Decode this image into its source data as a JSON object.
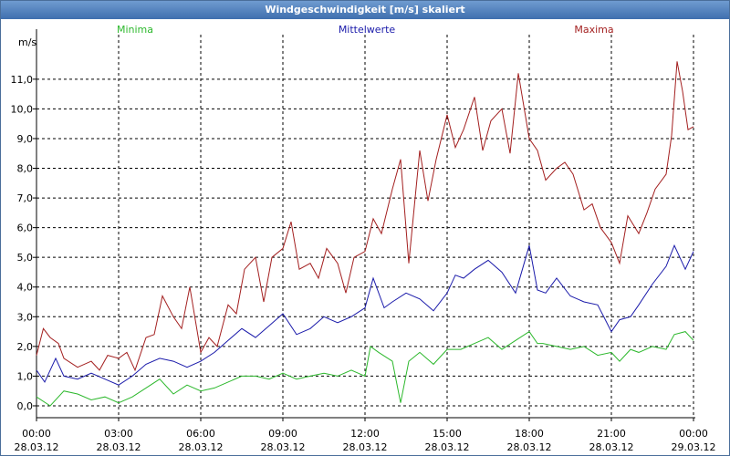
{
  "window": {
    "title": "Windgeschwindigkeit [m/s] skaliert"
  },
  "chart_data": {
    "type": "line",
    "title": "Windgeschwindigkeit [m/s] skaliert",
    "ylabel": "m/s",
    "ylim": [
      -0.4,
      12.5
    ],
    "xlim_hours": [
      0,
      24
    ],
    "yticks": [
      "0,0",
      "1,0",
      "2,0",
      "3,0",
      "4,0",
      "5,0",
      "6,0",
      "7,0",
      "8,0",
      "9,0",
      "10,0",
      "11,0"
    ],
    "xticks": [
      {
        "time": "00:00",
        "date": "28.03.12"
      },
      {
        "time": "03:00",
        "date": "28.03.12"
      },
      {
        "time": "06:00",
        "date": "28.03.12"
      },
      {
        "time": "09:00",
        "date": "28.03.12"
      },
      {
        "time": "12:00",
        "date": "28.03.12"
      },
      {
        "time": "15:00",
        "date": "28.03.12"
      },
      {
        "time": "18:00",
        "date": "28.03.12"
      },
      {
        "time": "21:00",
        "date": "28.03.12"
      },
      {
        "time": "00:00",
        "date": "29.03.12"
      }
    ],
    "grid": true,
    "legend_placement": "top",
    "series": [
      {
        "name": "Minima",
        "color": "#2cb82c",
        "x": [
          0,
          0.5,
          1,
          1.5,
          2,
          2.5,
          3,
          3.5,
          4,
          4.5,
          5,
          5.5,
          6,
          6.5,
          7,
          7.5,
          8,
          8.5,
          9,
          9.5,
          10,
          10.5,
          11,
          11.5,
          12,
          12.2,
          12.5,
          13,
          13.3,
          13.6,
          14,
          14.5,
          15,
          15.5,
          16,
          16.5,
          17,
          17.5,
          18,
          18.3,
          18.5,
          19,
          19.5,
          20,
          20.5,
          21,
          21.3,
          21.7,
          22,
          22.5,
          23,
          23.3,
          23.7,
          24
        ],
        "values": [
          0.3,
          0.0,
          0.5,
          0.4,
          0.2,
          0.3,
          0.1,
          0.3,
          0.6,
          0.9,
          0.4,
          0.7,
          0.5,
          0.6,
          0.8,
          1.0,
          1.0,
          0.9,
          1.1,
          0.9,
          1.0,
          1.1,
          1.0,
          1.2,
          1.0,
          2.0,
          1.8,
          1.5,
          0.1,
          1.5,
          1.8,
          1.4,
          1.9,
          1.9,
          2.1,
          2.3,
          1.9,
          2.2,
          2.5,
          2.1,
          2.1,
          2.0,
          1.9,
          2.0,
          1.7,
          1.8,
          1.5,
          1.9,
          1.8,
          2.0,
          1.9,
          2.4,
          2.5,
          2.2
        ]
      },
      {
        "name": "Mittelwerte",
        "color": "#1a1aaa",
        "x": [
          0,
          0.3,
          0.7,
          1,
          1.5,
          2,
          2.5,
          3,
          3.5,
          4,
          4.5,
          5,
          5.5,
          6,
          6.5,
          7,
          7.5,
          8,
          8.5,
          9,
          9.5,
          10,
          10.5,
          11,
          11.5,
          12,
          12.3,
          12.7,
          13,
          13.5,
          14,
          14.5,
          15,
          15.3,
          15.6,
          16,
          16.5,
          17,
          17.5,
          18,
          18.3,
          18.6,
          19,
          19.5,
          20,
          20.5,
          21,
          21.3,
          21.7,
          22,
          22.5,
          23,
          23.3,
          23.7,
          24
        ],
        "values": [
          1.2,
          0.8,
          1.6,
          1.0,
          0.9,
          1.1,
          0.9,
          0.7,
          1.0,
          1.4,
          1.6,
          1.5,
          1.3,
          1.5,
          1.8,
          2.2,
          2.6,
          2.3,
          2.7,
          3.1,
          2.4,
          2.6,
          3.0,
          2.8,
          3.0,
          3.3,
          4.3,
          3.3,
          3.5,
          3.8,
          3.6,
          3.2,
          3.8,
          4.4,
          4.3,
          4.6,
          4.9,
          4.5,
          3.8,
          5.4,
          3.9,
          3.8,
          4.3,
          3.7,
          3.5,
          3.4,
          2.5,
          2.9,
          3.0,
          3.4,
          4.1,
          4.7,
          5.4,
          4.6,
          5.2
        ]
      },
      {
        "name": "Maxima",
        "color": "#a31f1f",
        "x": [
          0,
          0.25,
          0.5,
          0.8,
          1,
          1.5,
          2,
          2.3,
          2.6,
          3,
          3.3,
          3.6,
          4,
          4.3,
          4.6,
          5,
          5.3,
          5.6,
          6,
          6.3,
          6.6,
          7,
          7.3,
          7.6,
          8,
          8.3,
          8.6,
          9,
          9.3,
          9.6,
          10,
          10.3,
          10.6,
          11,
          11.3,
          11.6,
          12,
          12.3,
          12.6,
          13,
          13.3,
          13.6,
          14,
          14.3,
          14.6,
          15,
          15.3,
          15.6,
          16,
          16.3,
          16.6,
          17,
          17.3,
          17.6,
          18,
          18.3,
          18.6,
          19,
          19.3,
          19.6,
          20,
          20.3,
          20.6,
          21,
          21.3,
          21.6,
          22,
          22.3,
          22.6,
          23,
          23.2,
          23.4,
          23.6,
          23.8,
          24
        ],
        "values": [
          1.7,
          2.6,
          2.3,
          2.1,
          1.6,
          1.3,
          1.5,
          1.2,
          1.7,
          1.6,
          1.8,
          1.2,
          2.3,
          2.4,
          3.7,
          3.0,
          2.6,
          4.0,
          1.8,
          2.3,
          2.0,
          3.4,
          3.1,
          4.6,
          5.0,
          3.5,
          5.0,
          5.3,
          6.2,
          4.6,
          4.8,
          4.3,
          5.3,
          4.8,
          3.8,
          5.0,
          5.2,
          6.3,
          5.8,
          7.3,
          8.3,
          4.8,
          8.6,
          6.9,
          8.3,
          9.8,
          8.7,
          9.3,
          10.4,
          8.6,
          9.6,
          10.0,
          8.5,
          11.2,
          9.0,
          8.6,
          7.6,
          8.0,
          8.2,
          7.8,
          6.6,
          6.8,
          6.0,
          5.5,
          4.8,
          6.4,
          5.8,
          6.5,
          7.3,
          7.8,
          9.1,
          11.6,
          10.6,
          9.3,
          9.4
        ]
      }
    ]
  }
}
